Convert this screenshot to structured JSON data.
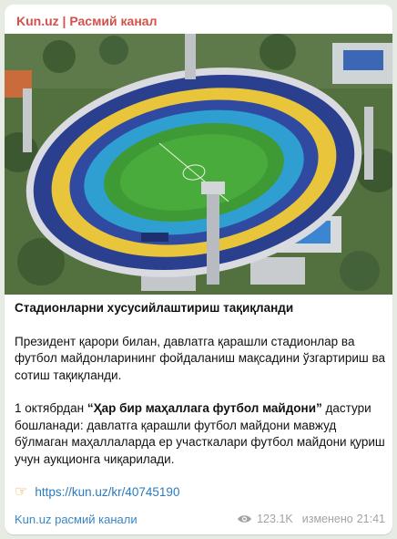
{
  "channel_name": "Kun.uz | Расмий канал",
  "post": {
    "title": "Стадионларни хусусийлаштириш тақиқланди",
    "paragraph1": "Президент қарори билан, давлатга қарашли стадионлар ва футбол майдонларининг фойдаланиш мақсадини ўзгартириш ва сотиш тақиқланди.",
    "paragraph2_start": "1 октябрдан ",
    "paragraph2_bold": "“Ҳар бир маҳаллага футбол майдони”",
    "paragraph2_end": " дастури бошланади: давлатга қарашли футбол майдони мавжуд бўлмаган маҳаллаларда ер участкалари футбол майдони қуриш учун аукционга чиқарилади.",
    "link_icon": "pointing-hand-icon",
    "link": "https://kun.uz/kr/40745190"
  },
  "footer": {
    "channel_link": "Kun.uz расмий канали",
    "views": "123.1K",
    "edited_label": "изменено",
    "time": "21:41"
  },
  "colors": {
    "channel_name": "#d4514b",
    "link": "#2b7bbd",
    "meta": "#a3a3a3",
    "background": "#e6ebe4"
  }
}
